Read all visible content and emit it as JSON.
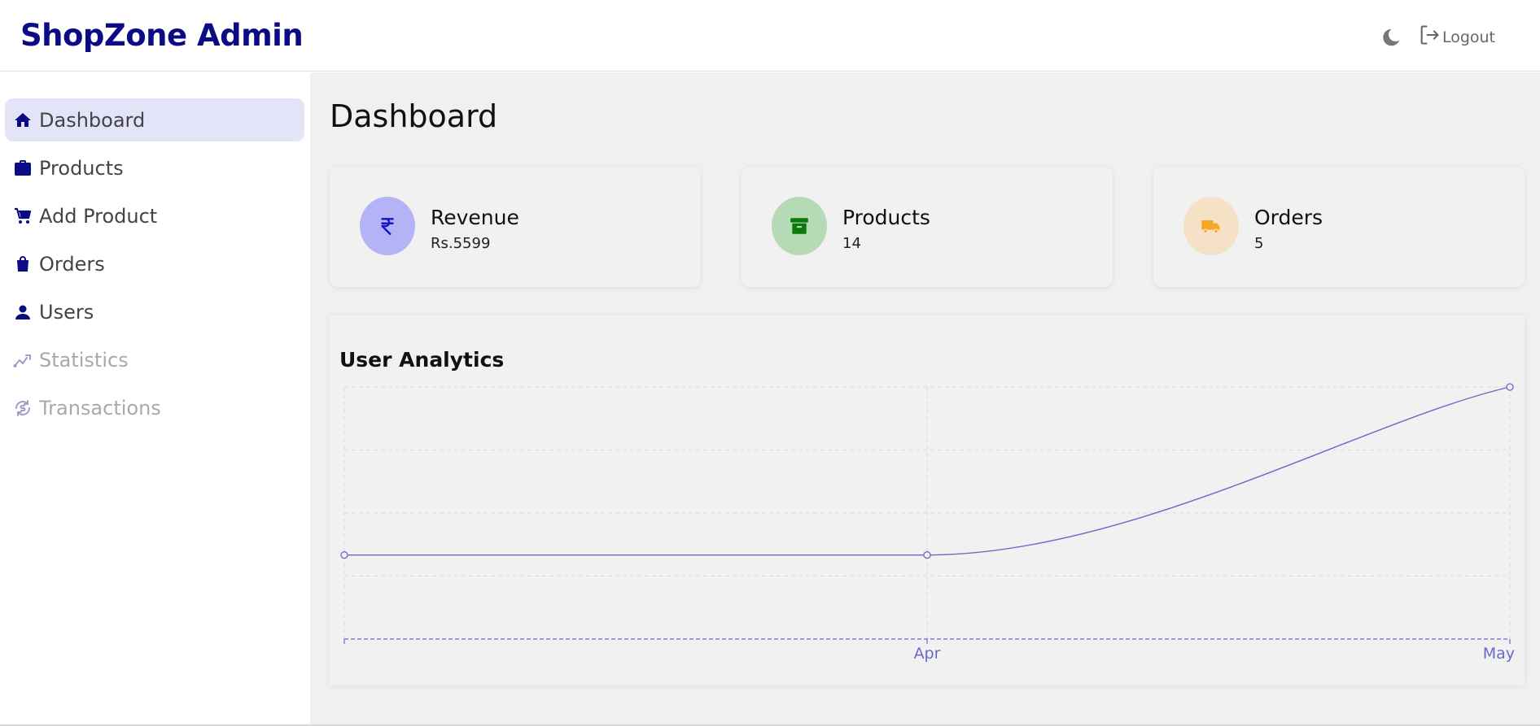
{
  "app": {
    "title": "ShopZone Admin"
  },
  "header": {
    "theme_icon": "moon-icon",
    "logout_icon": "logout-icon",
    "logout_label": "Logout"
  },
  "sidebar": {
    "items": [
      {
        "label": "Dashboard",
        "icon": "home-icon",
        "active": true,
        "disabled": false
      },
      {
        "label": "Products",
        "icon": "briefcase-icon",
        "active": false,
        "disabled": false
      },
      {
        "label": "Add Product",
        "icon": "cart-icon",
        "active": false,
        "disabled": false
      },
      {
        "label": "Orders",
        "icon": "shopping-bag-icon",
        "active": false,
        "disabled": false
      },
      {
        "label": "Users",
        "icon": "user-icon",
        "active": false,
        "disabled": false
      },
      {
        "label": "Statistics",
        "icon": "trend-icon",
        "active": false,
        "disabled": true
      },
      {
        "label": "Transactions",
        "icon": "exchange-icon",
        "active": false,
        "disabled": true
      }
    ]
  },
  "main": {
    "title": "Dashboard",
    "cards": [
      {
        "title": "Revenue",
        "value": "Rs.5599",
        "icon": "rupee-icon",
        "icon_bg": "#b3b3f5",
        "icon_color": "#1515c8"
      },
      {
        "title": "Products",
        "value": "14",
        "icon": "archive-icon",
        "icon_bg": "#b6d9b6",
        "icon_color": "#0a7a0a"
      },
      {
        "title": "Orders",
        "value": "5",
        "icon": "truck-icon",
        "icon_bg": "#f5e2c6",
        "icon_color": "#f5a623"
      }
    ]
  },
  "chart_data": {
    "type": "line",
    "title": "User Analytics",
    "categories": [
      "",
      "Apr",
      "May"
    ],
    "series": [
      {
        "values": [
          1,
          1,
          3
        ]
      }
    ],
    "ylim": [
      0,
      3
    ],
    "grid": true,
    "line_color": "#6a6ac4"
  },
  "colors": {
    "brand": "#0b0b85",
    "active_bg": "#e4e4f8",
    "main_bg": "#f0f0f0"
  }
}
